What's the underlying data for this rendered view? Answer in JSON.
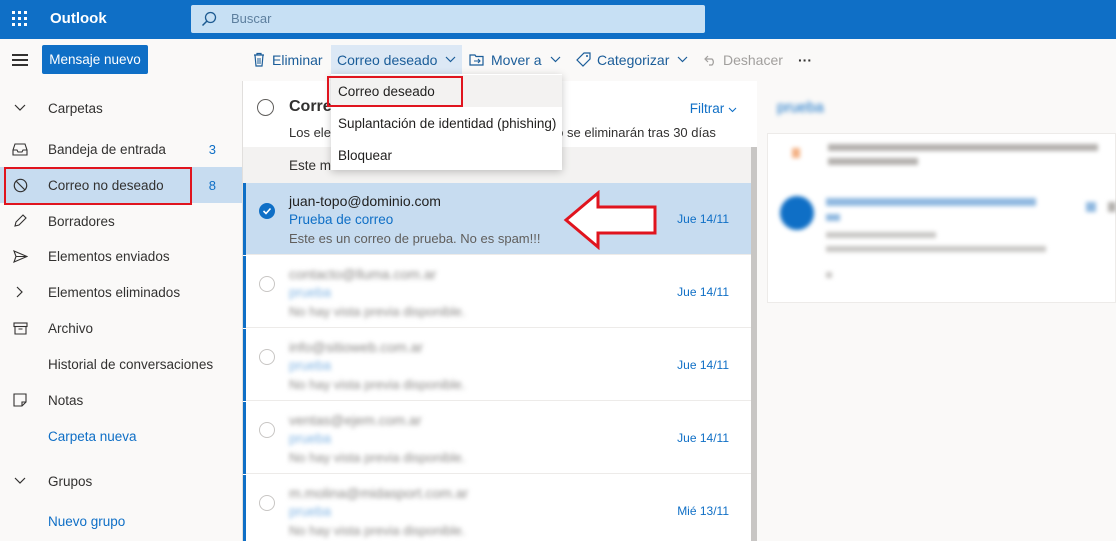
{
  "app": {
    "name": "Outlook"
  },
  "search": {
    "placeholder": "Buscar"
  },
  "toolbar": {
    "new_message": "Mensaje nuevo",
    "delete": "Eliminar",
    "junk": "Correo deseado",
    "move": "Mover a",
    "categorize": "Categorizar",
    "undo": "Deshacer",
    "more": "···"
  },
  "junk_menu": {
    "items": [
      "Correo deseado",
      "Suplantación de identidad (phishing)",
      "Bloquear"
    ]
  },
  "nav": {
    "folders_header": "Carpetas",
    "items": [
      {
        "label": "Bandeja de entrada",
        "count": "3",
        "icon": "inbox-icon"
      },
      {
        "label": "Correo no deseado",
        "count": "8",
        "icon": "blocked-icon"
      },
      {
        "label": "Borradores",
        "count": "",
        "icon": "pencil-icon"
      },
      {
        "label": "Elementos enviados",
        "count": "",
        "icon": "send-icon"
      },
      {
        "label": "Elementos eliminados",
        "count": "",
        "icon": "chevron-right-icon"
      },
      {
        "label": "Archivo",
        "count": "",
        "icon": "archive-icon"
      },
      {
        "label": "Historial de conversaciones",
        "count": "",
        "icon": ""
      },
      {
        "label": "Notas",
        "count": "",
        "icon": "note-icon"
      }
    ],
    "new_folder": "Carpeta nueva",
    "groups_header": "Grupos",
    "new_group": "Nuevo grupo"
  },
  "list": {
    "title": "Correo",
    "filter": "Filtrar",
    "notice": "Los ele                                                        do se eliminarán tras 30 días",
    "notice_left": "Los ele",
    "notice_right": "do se eliminarán tras 30 días",
    "group_header": "Este m",
    "messages": [
      {
        "from": "juan-topo@dominio.com",
        "subject": "Prueba de correo",
        "preview": "Este es un correo de prueba. No es spam!!!",
        "date": "Jue 14/11",
        "selected": true
      },
      {
        "from": "contacto@lluma.com.ar",
        "subject": "prueba",
        "preview": "No hay vista previa disponible.",
        "date": "Jue 14/11",
        "selected": false
      },
      {
        "from": "info@sitioweb.com.ar",
        "subject": "prueba",
        "preview": "No hay vista previa disponible.",
        "date": "Jue 14/11",
        "selected": false
      },
      {
        "from": "ventas@ejem.com.ar",
        "subject": "prueba",
        "preview": "No hay vista previa disponible.",
        "date": "Jue 14/11",
        "selected": false
      },
      {
        "from": "m.molina@midasport.com.ar",
        "subject": "prueba",
        "preview": "No hay vista previa disponible.",
        "date": "Mié 13/11",
        "selected": false
      }
    ]
  },
  "reading": {
    "title": "prueba"
  },
  "colors": {
    "brand": "#0f6fc6",
    "highlight": "#e0141e",
    "selection": "#c7dcf0"
  }
}
